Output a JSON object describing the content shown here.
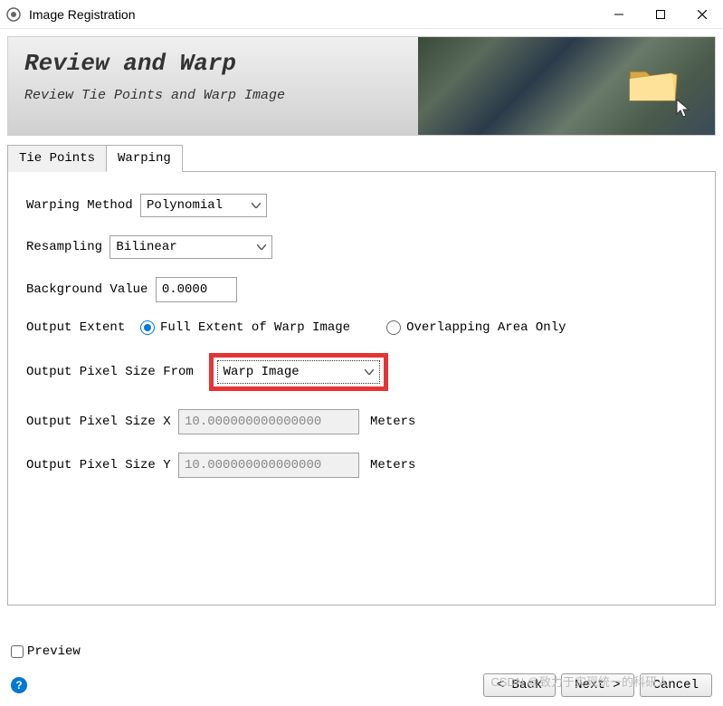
{
  "window": {
    "title": "Image Registration"
  },
  "header": {
    "title": "Review and Warp",
    "subtitle": "Review Tie Points and Warp Image"
  },
  "tabs": {
    "tie_points": "Tie Points",
    "warping": "Warping",
    "active": "warping"
  },
  "form": {
    "warping_method": {
      "label": "Warping Method ",
      "value": "Polynomial"
    },
    "resampling": {
      "label": "Resampling ",
      "value": "Bilinear"
    },
    "background_value": {
      "label": "Background Value ",
      "value": "0.0000"
    },
    "output_extent": {
      "label": "Output Extent  ",
      "option_full": "Full Extent of Warp Image",
      "option_overlap": "Overlapping Area Only",
      "selected": "full"
    },
    "pixel_size_from": {
      "label": "Output Pixel Size From  ",
      "value": "Warp Image"
    },
    "pixel_size_x": {
      "label": "Output Pixel Size X ",
      "value": "10.000000000000000",
      "unit": "Meters"
    },
    "pixel_size_y": {
      "label": "Output Pixel Size Y ",
      "value": "10.000000000000000",
      "unit": "Meters"
    }
  },
  "preview": {
    "label": "Preview",
    "checked": false
  },
  "footer": {
    "back": "< Back",
    "next": "Next >",
    "cancel": "Cancel"
  },
  "watermark": "CSDN @致力于实现统一的科研人"
}
